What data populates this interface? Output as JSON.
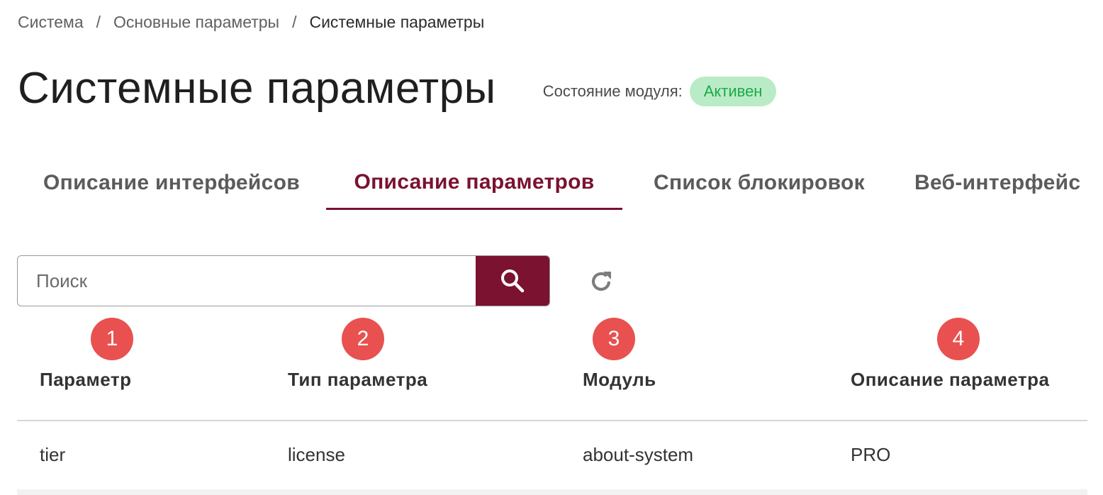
{
  "breadcrumb": {
    "items": [
      "Система",
      "Основные параметры",
      "Системные параметры"
    ],
    "separator": "/"
  },
  "header": {
    "title": "Системные параметры",
    "module_state_label": "Состояние модуля:",
    "module_state_value": "Активен"
  },
  "tabs": [
    {
      "label": "Описание интерфейсов",
      "active": false
    },
    {
      "label": "Описание параметров",
      "active": true
    },
    {
      "label": "Список блокировок",
      "active": false
    },
    {
      "label": "Веб-интерфейс",
      "active": false
    }
  ],
  "search": {
    "placeholder": "Поиск",
    "search_icon": "search-icon",
    "refresh_icon": "refresh-icon"
  },
  "markers": [
    "1",
    "2",
    "3",
    "4"
  ],
  "table": {
    "columns": [
      "Параметр",
      "Тип параметра",
      "Модуль",
      "Описание параметра"
    ],
    "rows": [
      [
        "tier",
        "license",
        "about-system",
        "PRO"
      ]
    ]
  },
  "colors": {
    "accent": "#7a1230",
    "status_bg": "#b9ecc6",
    "status_text": "#1ea84a",
    "marker": "#e8514f"
  }
}
